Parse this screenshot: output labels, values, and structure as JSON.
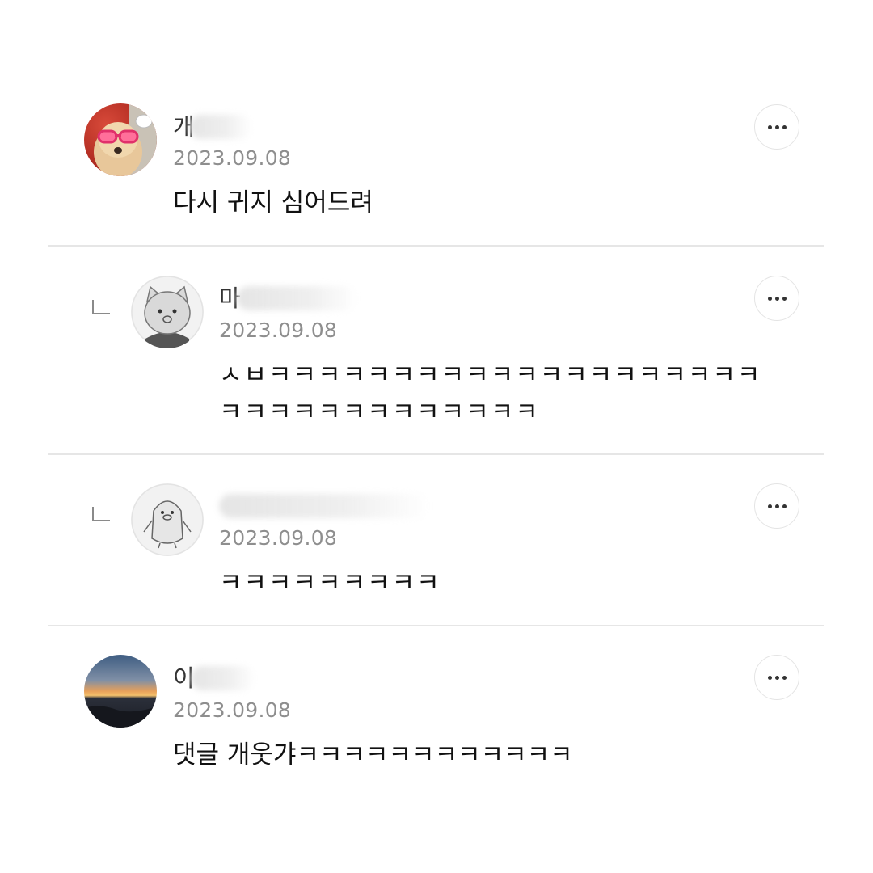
{
  "comments": [
    {
      "author": "개",
      "date": "2023.09.08",
      "text": "다시 귀지 심어드려",
      "avatar": "dog-with-pink-sunglasses-avatar",
      "more_icon": "more-dots-icon"
    },
    {
      "author": "마",
      "date": "2023.09.08",
      "text": "ㅅㅂㅋㅋㅋㅋㅋㅋㅋㅋㅋㅋㅋㅋㅋㅋㅋㅋㅋㅋㅋㅋㅋㅋㅋㅋㅋㅋㅋㅋㅋㅋㅋㅋㅋ",
      "avatar": "default-cat-character-avatar",
      "reply_icon": "reply-corner-icon",
      "more_icon": "more-dots-icon"
    },
    {
      "author": "",
      "date": "2023.09.08",
      "text": "ㅋㅋㅋㅋㅋㅋㅋㅋㅋ",
      "avatar": "default-penguin-character-avatar",
      "reply_icon": "reply-corner-icon",
      "more_icon": "more-dots-icon"
    },
    {
      "author": "이",
      "date": "2023.09.08",
      "text": "댓글 개웃갸ㅋㅋㅋㅋㅋㅋㅋㅋㅋㅋㅋㅋ",
      "avatar": "sunset-sea-photo-avatar",
      "more_icon": "more-dots-icon"
    }
  ],
  "colors": {
    "date": "#8e8e8e",
    "divider": "#e6e6e6",
    "text": "#111111"
  }
}
